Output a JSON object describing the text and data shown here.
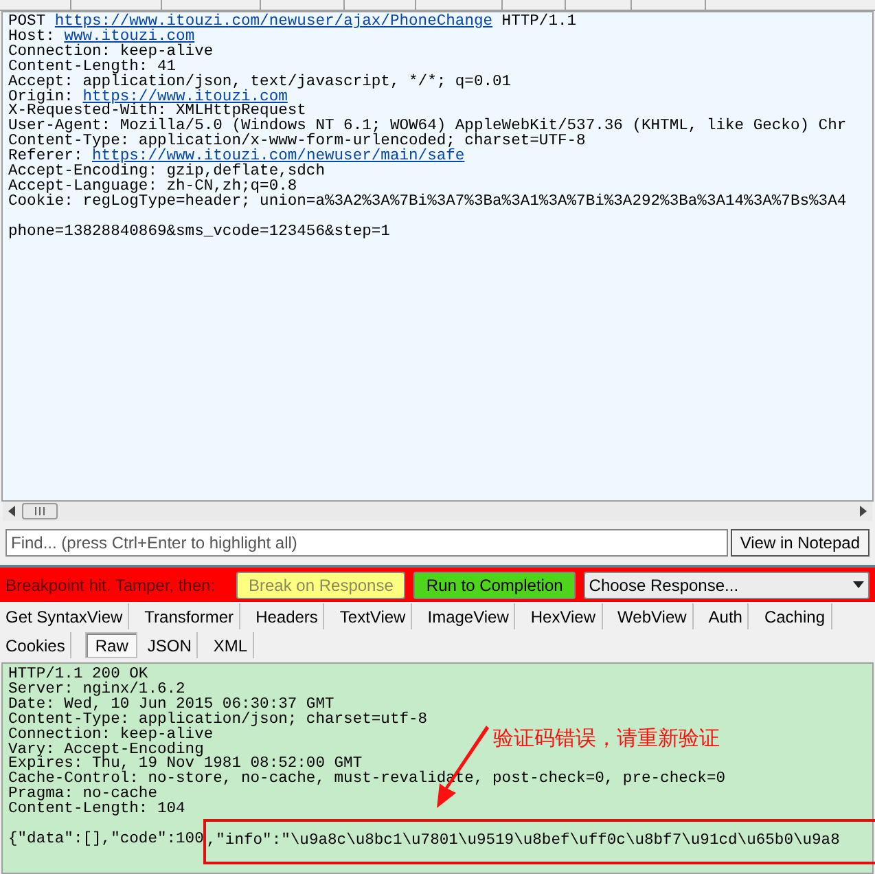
{
  "request": {
    "lines": [
      {
        "segments": [
          {
            "text": "POST "
          },
          {
            "text": "https://www.itouzi.com/newuser/ajax/PhoneChange",
            "link": true
          },
          {
            "text": " HTTP/1.1"
          }
        ]
      },
      {
        "segments": [
          {
            "text": "Host: "
          },
          {
            "text": "www.itouzi.com",
            "link": true
          }
        ]
      },
      {
        "segments": [
          {
            "text": "Connection: keep-alive"
          }
        ]
      },
      {
        "segments": [
          {
            "text": "Content-Length: 41"
          }
        ]
      },
      {
        "segments": [
          {
            "text": "Accept: application/json, text/javascript, */*; q=0.01"
          }
        ]
      },
      {
        "segments": [
          {
            "text": "Origin: "
          },
          {
            "text": "https://www.itouzi.com",
            "link": true
          }
        ]
      },
      {
        "segments": [
          {
            "text": "X-Requested-With: XMLHttpRequest"
          }
        ]
      },
      {
        "segments": [
          {
            "text": "User-Agent: Mozilla/5.0 (Windows NT 6.1; WOW64) AppleWebKit/537.36 (KHTML, like Gecko) Chr"
          }
        ]
      },
      {
        "segments": [
          {
            "text": "Content-Type: application/x-www-form-urlencoded; charset=UTF-8"
          }
        ]
      },
      {
        "segments": [
          {
            "text": "Referer: "
          },
          {
            "text": "https://www.itouzi.com/newuser/main/safe",
            "link": true
          }
        ]
      },
      {
        "segments": [
          {
            "text": "Accept-Encoding: gzip,deflate,sdch"
          }
        ]
      },
      {
        "segments": [
          {
            "text": "Accept-Language: zh-CN,zh;q=0.8"
          }
        ]
      },
      {
        "segments": [
          {
            "text": "Cookie: regLogType=header; union=a%3A2%3A%7Bi%3A7%3Ba%3A1%3A%7Bi%3A292%3Ba%3A14%3A%7Bs%3A4"
          }
        ]
      },
      {
        "kind": "blank"
      },
      {
        "segments": [
          {
            "text": "phone=13828840869&sms_vcode=123456&step=1"
          }
        ]
      }
    ]
  },
  "find": {
    "placeholder": "Find... (press Ctrl+Enter to highlight all)"
  },
  "view_button": "View in Notepad",
  "breakpoint": {
    "message": "Breakpoint hit. Tamper, then:",
    "buttons": [
      {
        "label": "Break on Response",
        "kind": "break"
      },
      {
        "label": "Run to Completion",
        "kind": "run"
      }
    ],
    "dropdown": "Choose Response..."
  },
  "tabs": [
    [
      {
        "label": "Get SyntaxView",
        "selected": false
      },
      {
        "label": "Transformer",
        "selected": false
      },
      {
        "label": "Headers",
        "selected": false
      },
      {
        "label": "TextView",
        "selected": false
      },
      {
        "label": "ImageView",
        "selected": false
      },
      {
        "label": "HexView",
        "selected": false
      },
      {
        "label": "WebView",
        "selected": false
      },
      {
        "label": "Auth",
        "selected": false
      },
      {
        "label": "Caching",
        "selected": false
      }
    ],
    [
      {
        "label": "Cookies",
        "selected": false
      },
      {
        "label": "Raw",
        "selected": true
      },
      {
        "label": "JSON",
        "selected": false
      },
      {
        "label": "XML",
        "selected": false
      }
    ]
  ],
  "response": {
    "lines": [
      {
        "segments": [
          {
            "text": "HTTP/1.1 200 OK"
          }
        ]
      },
      {
        "segments": [
          {
            "text": "Server: nginx/1.6.2"
          }
        ]
      },
      {
        "segments": [
          {
            "text": "Date: Wed, 10 Jun 2015 06:30:37 GMT"
          }
        ]
      },
      {
        "segments": [
          {
            "text": "Content-Type: application/json; charset=utf-8"
          }
        ]
      },
      {
        "segments": [
          {
            "text": "Connection: keep-alive"
          }
        ]
      },
      {
        "segments": [
          {
            "text": "Vary: Accept-Encoding"
          }
        ]
      },
      {
        "segments": [
          {
            "text": "Expires: Thu, 19 Nov 1981 08:52:00 GMT"
          }
        ]
      },
      {
        "segments": [
          {
            "text": "Cache-Control: no-store, no-cache, must-revalidate, post-check=0, pre-check=0"
          }
        ]
      },
      {
        "segments": [
          {
            "text": "Pragma: no-cache"
          }
        ]
      },
      {
        "segments": [
          {
            "text": "Content-Length: 104"
          }
        ]
      },
      {
        "kind": "blank"
      },
      {
        "segments": [
          {
            "text": "{\"data\":[],\"code\":100"
          },
          {
            "text": ",\"info\":\"\\u9a8c\\u8bc1\\u7801\\u9519\\u8bef\\uff0c\\u8bf7\\u91cd\\u65b0\\u9a8",
            "highlighted": true
          }
        ]
      }
    ],
    "annotation": "验证码错误，请重新验证"
  }
}
